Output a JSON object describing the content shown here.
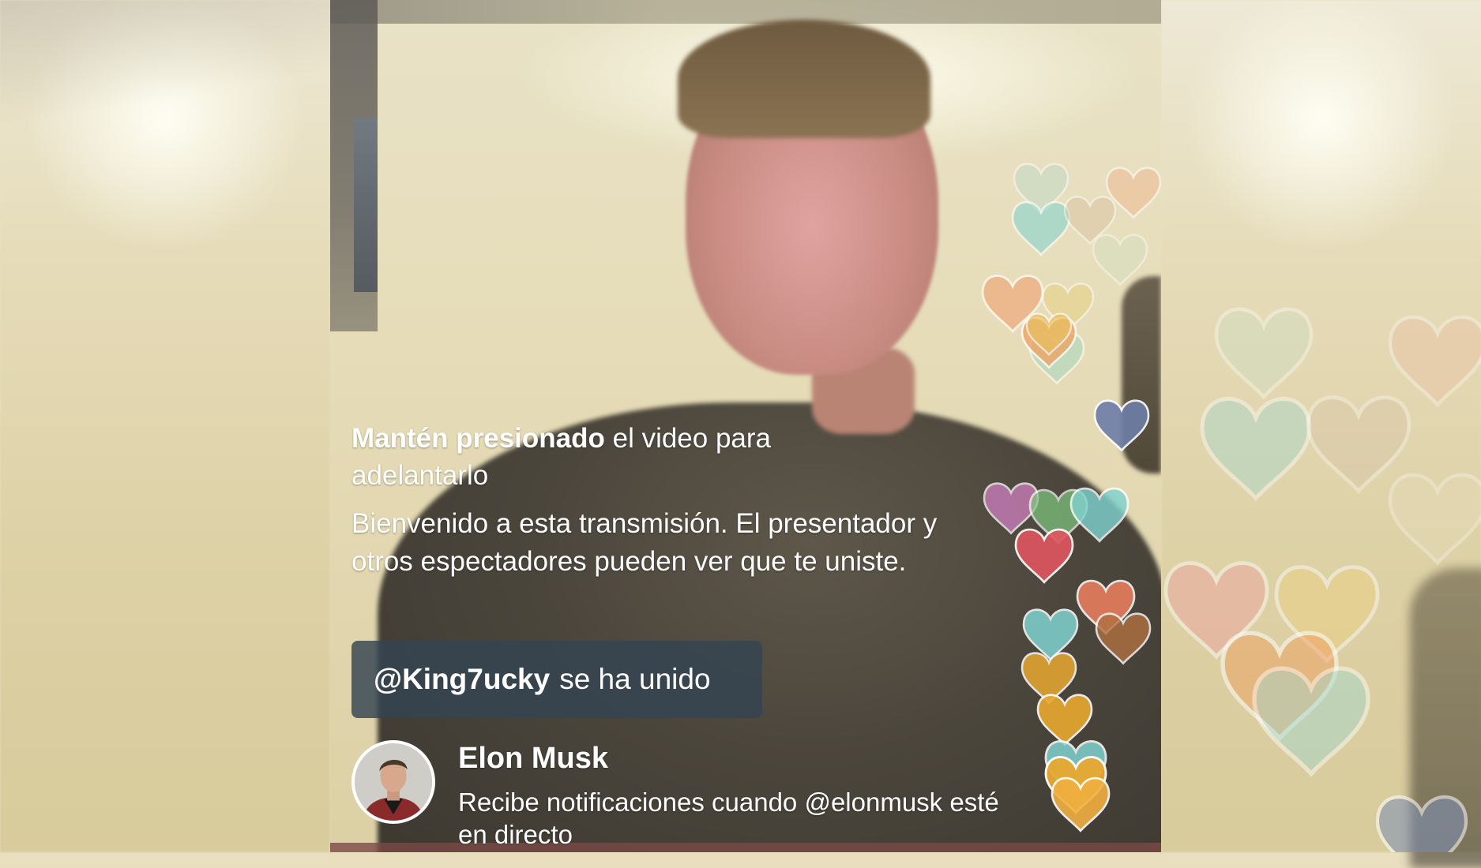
{
  "overlay": {
    "hint_bold": "Mantén presionado",
    "hint_rest": " el video para adelantarlo",
    "welcome": "Bienvenido a esta transmisión. El presentador y otros espectadores pueden ver que te uniste."
  },
  "join_notice": {
    "handle": "@King7ucky",
    "text": "se ha unido"
  },
  "host": {
    "name": "Elon Musk",
    "subscribe_text": "Recibe notificaciones cuando @elonmusk esté en directo"
  },
  "icons": {
    "reaction": "heart-icon"
  },
  "colors": {
    "pill_bg": "#344452",
    "heart_teal": "#7fd3d0",
    "heart_orange": "#f0a070",
    "heart_gold": "#e8a830",
    "heart_red": "#e05560",
    "heart_purple": "#d080c0",
    "heart_navy": "#6e7ea8",
    "heart_brown": "#b07040"
  }
}
